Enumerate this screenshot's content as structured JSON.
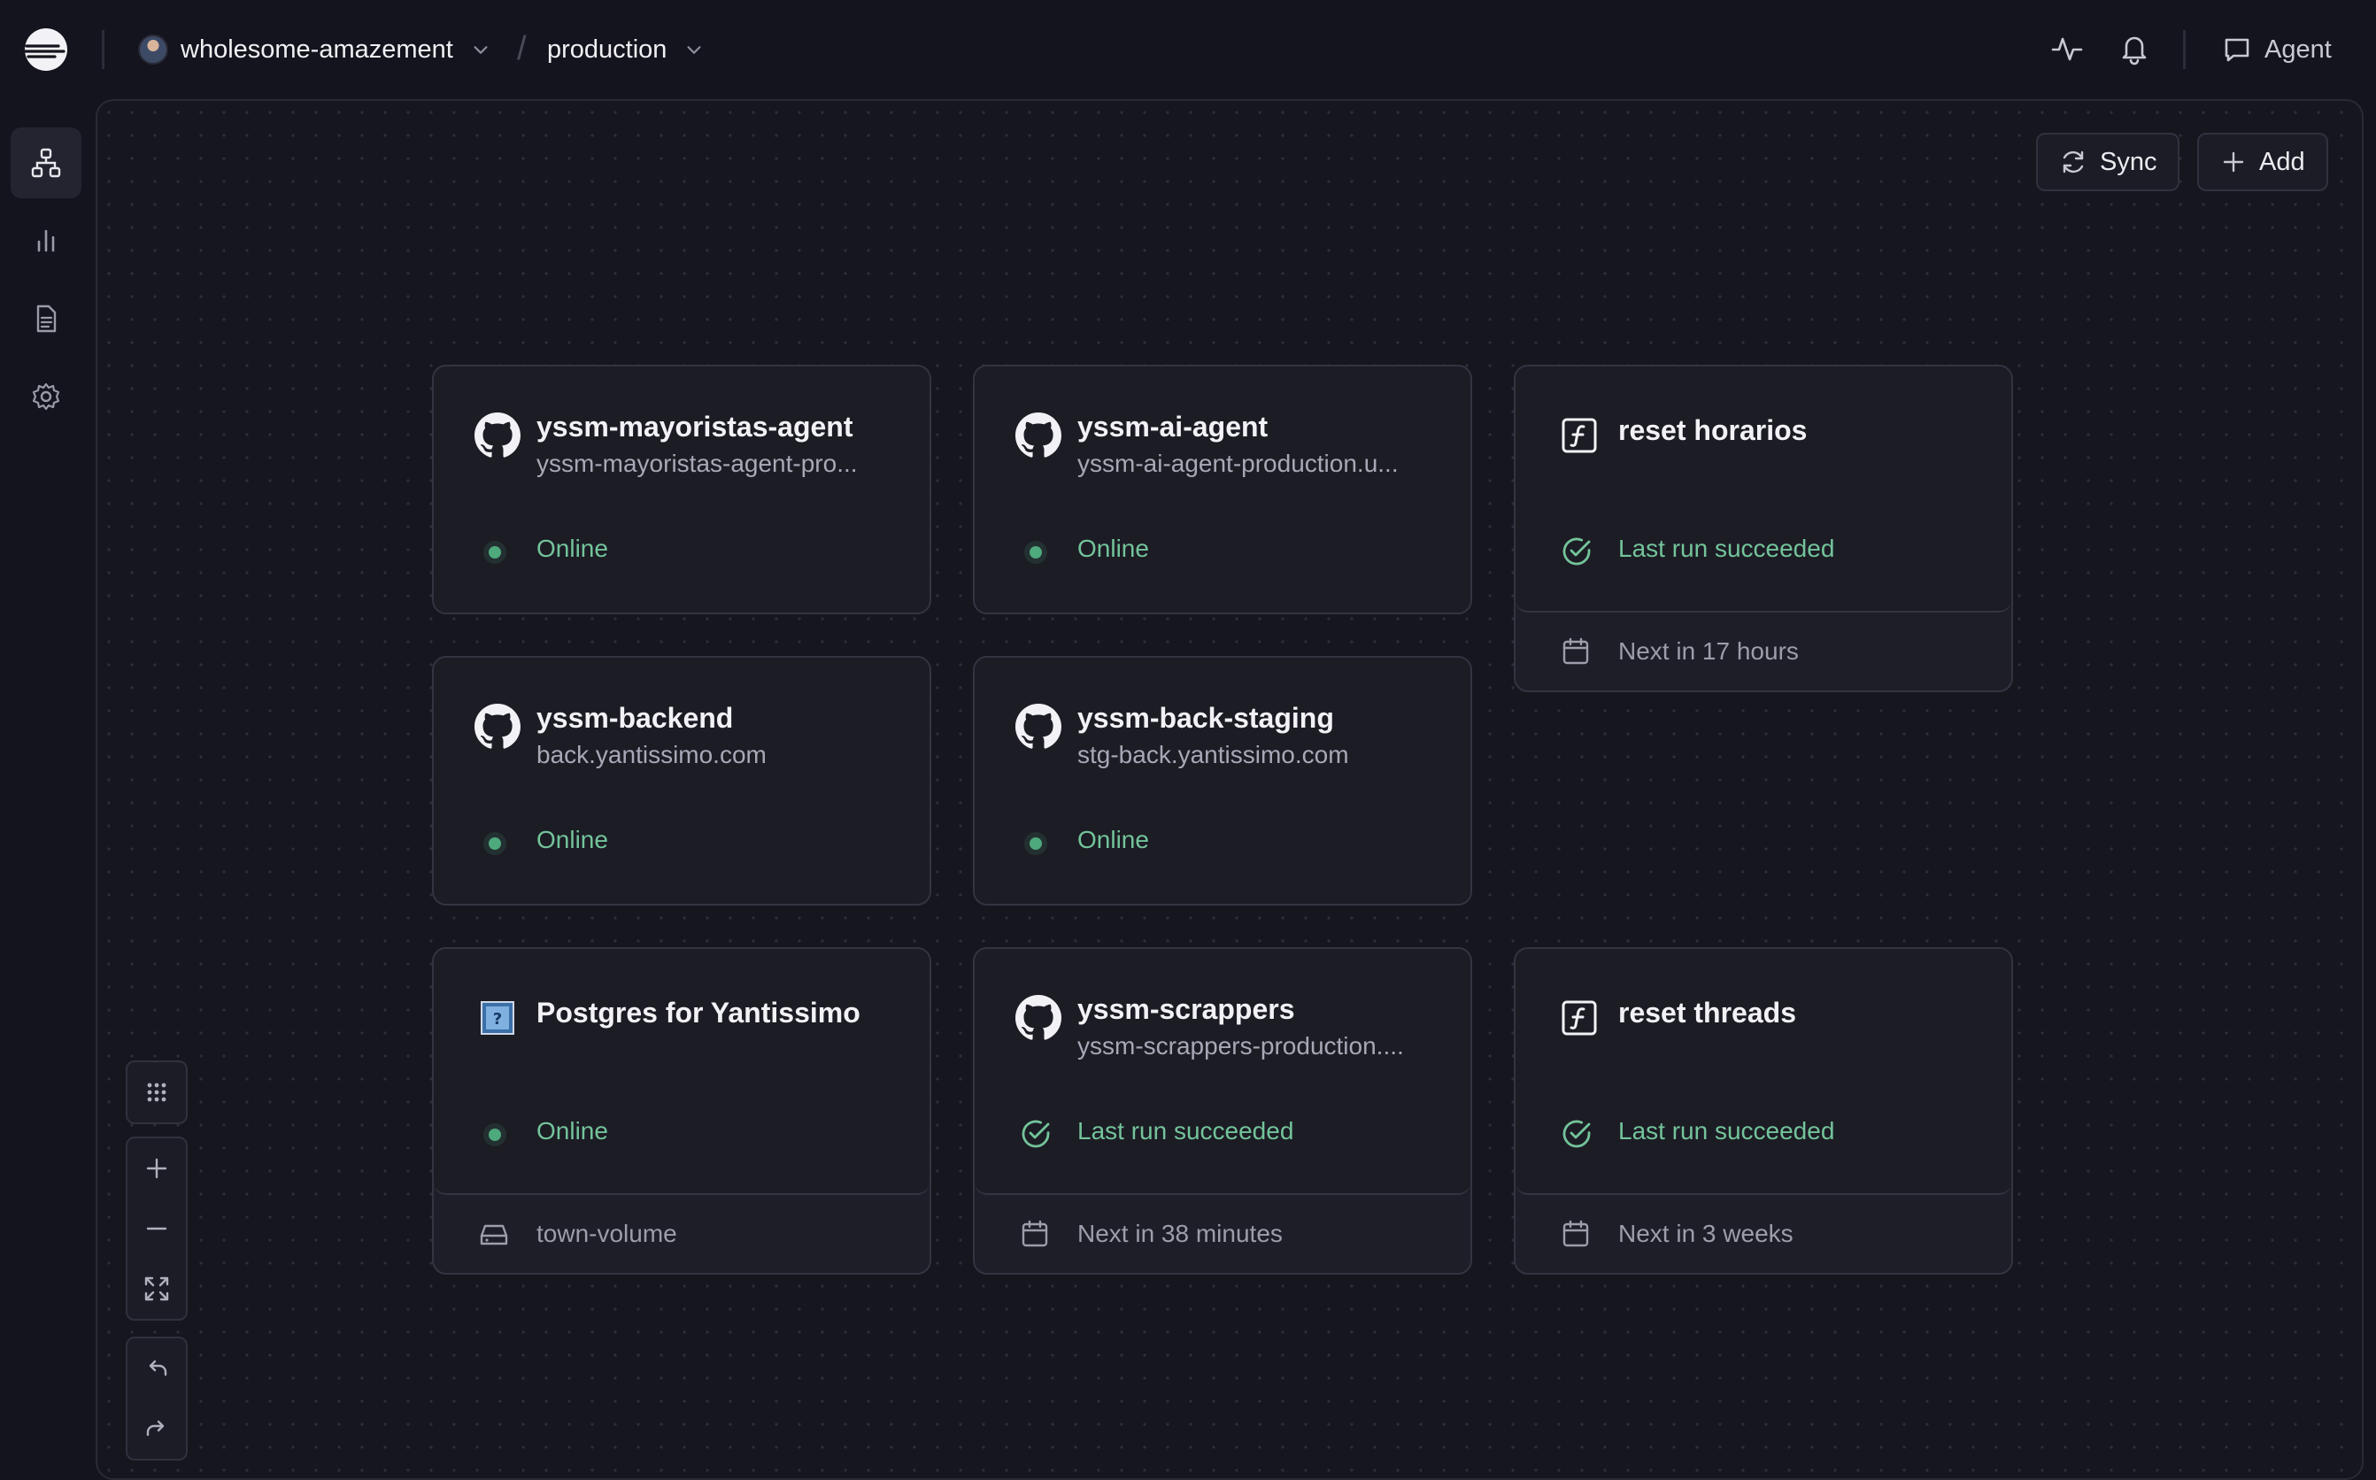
{
  "header": {
    "project_name": "wholesome-amazement",
    "environment": "production",
    "agent_label": "Agent"
  },
  "toolbar": {
    "sync_label": "Sync",
    "add_label": "Add"
  },
  "colors": {
    "background": "#14141e",
    "card": "#1c1c25",
    "status_green": "#73c49a",
    "border": "#343441"
  },
  "services": [
    {
      "name": "yssm-mayoristas-agent",
      "subtitle": "yssm-mayoristas-agent-pro...",
      "status": "Online",
      "icon": "github-icon"
    },
    {
      "name": "yssm-ai-agent",
      "subtitle": "yssm-ai-agent-production.u...",
      "status": "Online",
      "icon": "github-icon"
    },
    {
      "name": "reset horarios",
      "status": "Last run succeeded",
      "footer": "Next in 17 hours",
      "icon": "function-icon"
    },
    {
      "name": "yssm-backend",
      "subtitle": "back.yantissimo.com",
      "status": "Online",
      "icon": "github-icon"
    },
    {
      "name": "yssm-back-staging",
      "subtitle": "stg-back.yantissimo.com",
      "status": "Online",
      "icon": "github-icon"
    },
    {
      "name": "Postgres for Yantissimo",
      "status": "Online",
      "footer": "town-volume",
      "icon": "database-icon"
    },
    {
      "name": "yssm-scrappers",
      "subtitle": "yssm-scrappers-production....",
      "status": "Last run succeeded",
      "footer": "Next in 38 minutes",
      "icon": "github-icon"
    },
    {
      "name": "reset threads",
      "status": "Last run succeeded",
      "footer": "Next in 3 weeks",
      "icon": "function-icon"
    }
  ]
}
